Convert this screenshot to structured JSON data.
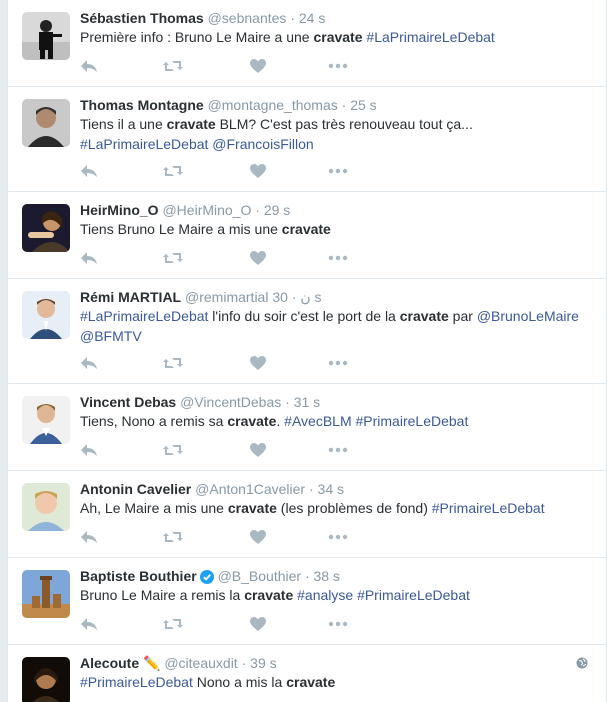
{
  "colors": {
    "link": "#3b5998",
    "muted": "#8899a6",
    "icon": "#aab8c2",
    "verified": "#1da1f2"
  },
  "tweets": [
    {
      "name": "Sébastien Thomas",
      "handle": "@sebnantes",
      "sep": "·",
      "time": "24 s",
      "segments": [
        {
          "t": "Première info : Bruno Le Maire a une "
        },
        {
          "t": "cravate",
          "b": true
        },
        {
          "t": " "
        },
        {
          "t": "#LaPrimaireLeDebat",
          "link": true
        }
      ]
    },
    {
      "name": "Thomas Montagne",
      "handle": "@montagne_thomas",
      "sep": "·",
      "time": "25 s",
      "segments": [
        {
          "t": "Tiens il a une "
        },
        {
          "t": "cravate",
          "b": true
        },
        {
          "t": " BLM? C'est pas très renouveau tout ça... "
        },
        {
          "t": "#LaPrimaireLeDebat",
          "link": true
        },
        {
          "t": " "
        },
        {
          "t": "@FrancoisFillon",
          "link": true
        }
      ]
    },
    {
      "name": "HeirMino_O",
      "handle": "@HeirMino_O",
      "sep": "·",
      "time": "29 s",
      "segments": [
        {
          "t": "Tiens Bruno Le Maire a mis une "
        },
        {
          "t": "cravate",
          "b": true
        }
      ]
    },
    {
      "name": "Rémi MARTIAL",
      "handle": "@remimartial",
      "extra": "ن",
      "sep": "·",
      "time": "30 s",
      "segments": [
        {
          "t": "#LaPrimaireLeDebat",
          "link": true
        },
        {
          "t": " l'info du soir c'est le port de la "
        },
        {
          "t": "cravate",
          "b": true
        },
        {
          "t": " par "
        },
        {
          "t": "@BrunoLeMaire",
          "link": true
        },
        {
          "t": " "
        },
        {
          "t": "@BFMTV",
          "link": true
        }
      ]
    },
    {
      "name": "Vincent Debas",
      "handle": "@VincentDebas",
      "sep": "·",
      "time": "31 s",
      "segments": [
        {
          "t": "Tiens, Nono a remis sa "
        },
        {
          "t": "cravate",
          "b": true
        },
        {
          "t": ". "
        },
        {
          "t": "#AvecBLM",
          "link": true
        },
        {
          "t": " "
        },
        {
          "t": "#PrimaireLeDebat",
          "link": true
        }
      ]
    },
    {
      "name": "Antonin Cavelier",
      "handle": "@Anton1Cavelier",
      "sep": "·",
      "time": "34 s",
      "segments": [
        {
          "t": "Ah, Le Maire a mis une "
        },
        {
          "t": "cravate",
          "b": true
        },
        {
          "t": " (les problèmes de fond) "
        },
        {
          "t": "#PrimaireLeDebat",
          "link": true
        }
      ]
    },
    {
      "name": "Baptiste Bouthier",
      "verified": true,
      "handle": "@B_Bouthier",
      "sep": "·",
      "time": "38 s",
      "segments": [
        {
          "t": "Bruno Le Maire a remis la "
        },
        {
          "t": "cravate",
          "b": true
        },
        {
          "t": " "
        },
        {
          "t": "#analyse",
          "link": true
        },
        {
          "t": " "
        },
        {
          "t": "#PrimaireLeDebat",
          "link": true
        }
      ]
    },
    {
      "name": "Alecoute",
      "emoji": "✏️",
      "handle": "@citeauxdit",
      "sep": "·",
      "time": "39 s",
      "geo": true,
      "segments": [
        {
          "t": "#PrimaireLeDebat",
          "link": true
        },
        {
          "t": " Nono a mis la "
        },
        {
          "t": "cravate",
          "b": true
        }
      ]
    }
  ]
}
